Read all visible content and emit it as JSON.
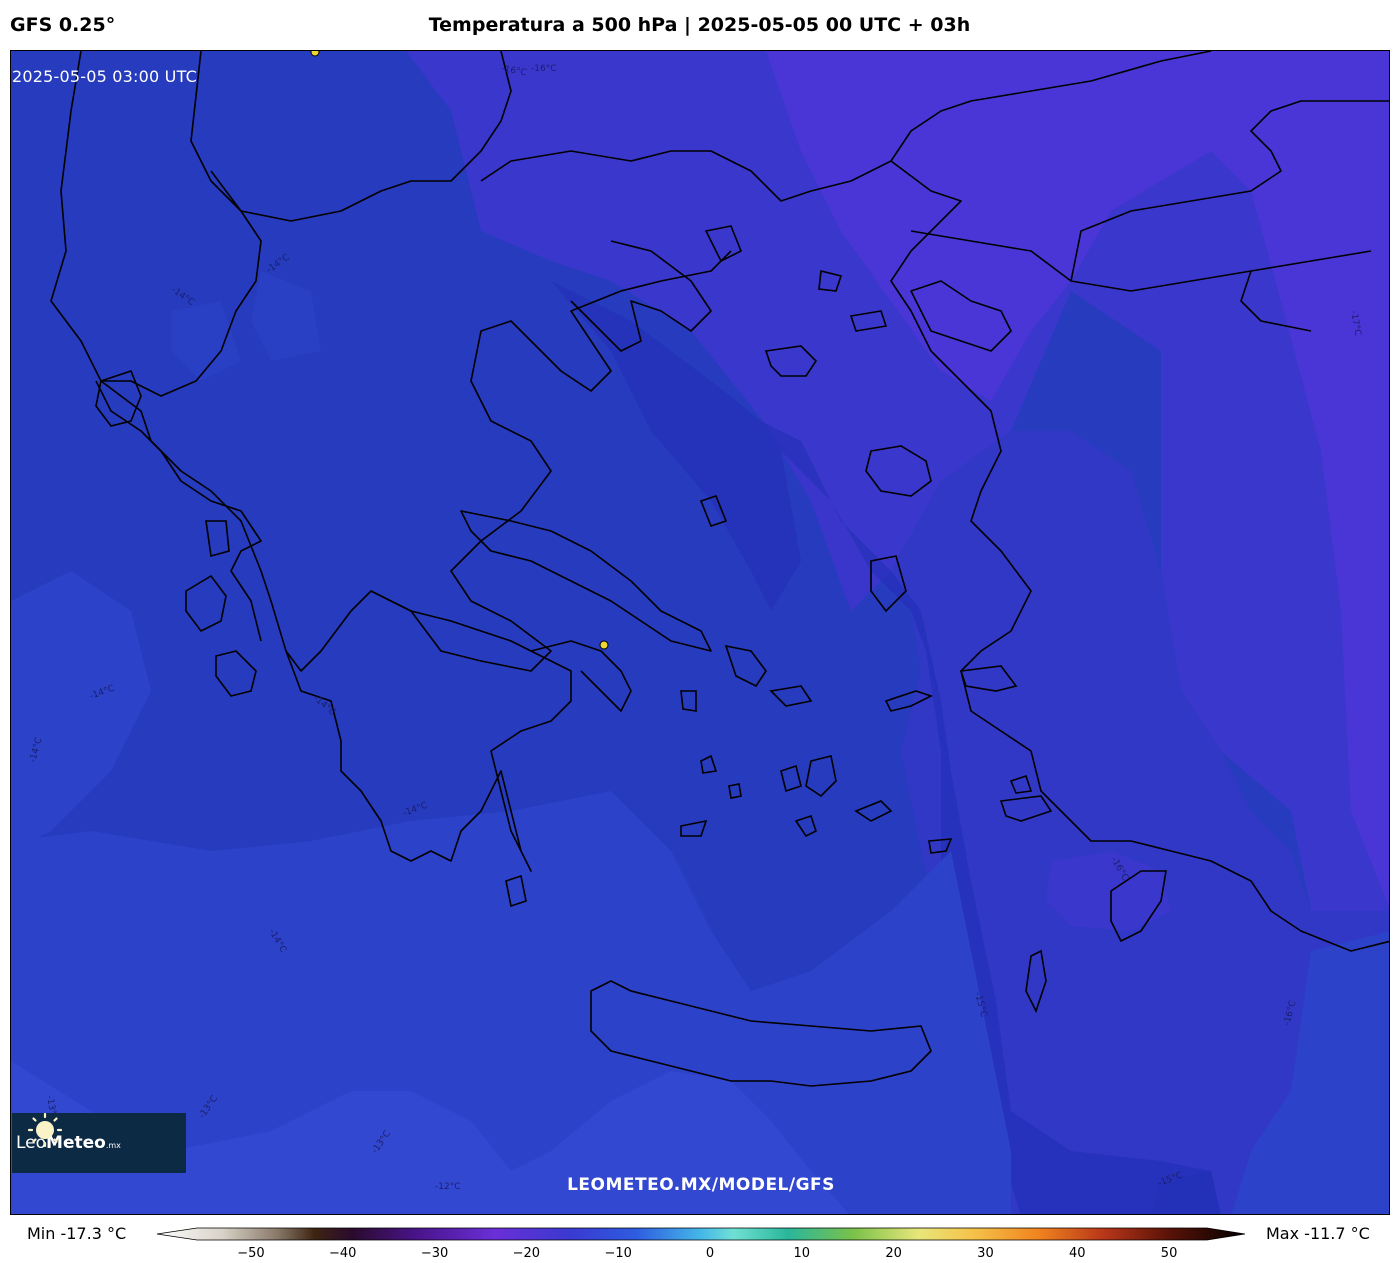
{
  "header": {
    "model": "GFS 0.25°",
    "title": "Temperatura a 500 hPa | 2025-05-05 00 UTC + 03h"
  },
  "map": {
    "valid_time": "2025-05-05 03:00 UTC",
    "watermark": "LEOMETEO.MX/MODEL/GFS",
    "contour_labels": [
      "-16°C",
      "-16°C",
      "-14°C",
      "-14°C",
      "-14°C",
      "-14°C",
      "-14°C",
      "-14°C",
      "-14°C",
      "-13°C",
      "-13°C",
      "-12°C",
      "-13°C",
      "-15°C",
      "-15°C",
      "-16°C",
      "-16°C",
      "-17°C"
    ],
    "colors": {
      "t_minus_12": "#3348d0",
      "t_minus_13": "#2c42c8",
      "t_minus_14": "#263bbe",
      "t_minus_15": "#2a36c4",
      "t_minus_16": "#3a37cc",
      "t_minus_17": "#4a36d6",
      "coastline": "#000000",
      "city_marker": "#f2d630"
    }
  },
  "logo": {
    "name_light": "Leo",
    "name_bold": "Meteo",
    "suffix": ".mx"
  },
  "colorbar": {
    "min_label": "Min -17.3 °C",
    "max_label": "Max -11.7 °C",
    "range": [
      -50,
      50
    ],
    "ticks": [
      "−50",
      "−40",
      "−30",
      "−20",
      "−10",
      "0",
      "10",
      "20",
      "30",
      "40",
      "50"
    ],
    "tick_values": [
      -50,
      -40,
      -30,
      -20,
      -10,
      0,
      10,
      20,
      30,
      40,
      50
    ]
  }
}
